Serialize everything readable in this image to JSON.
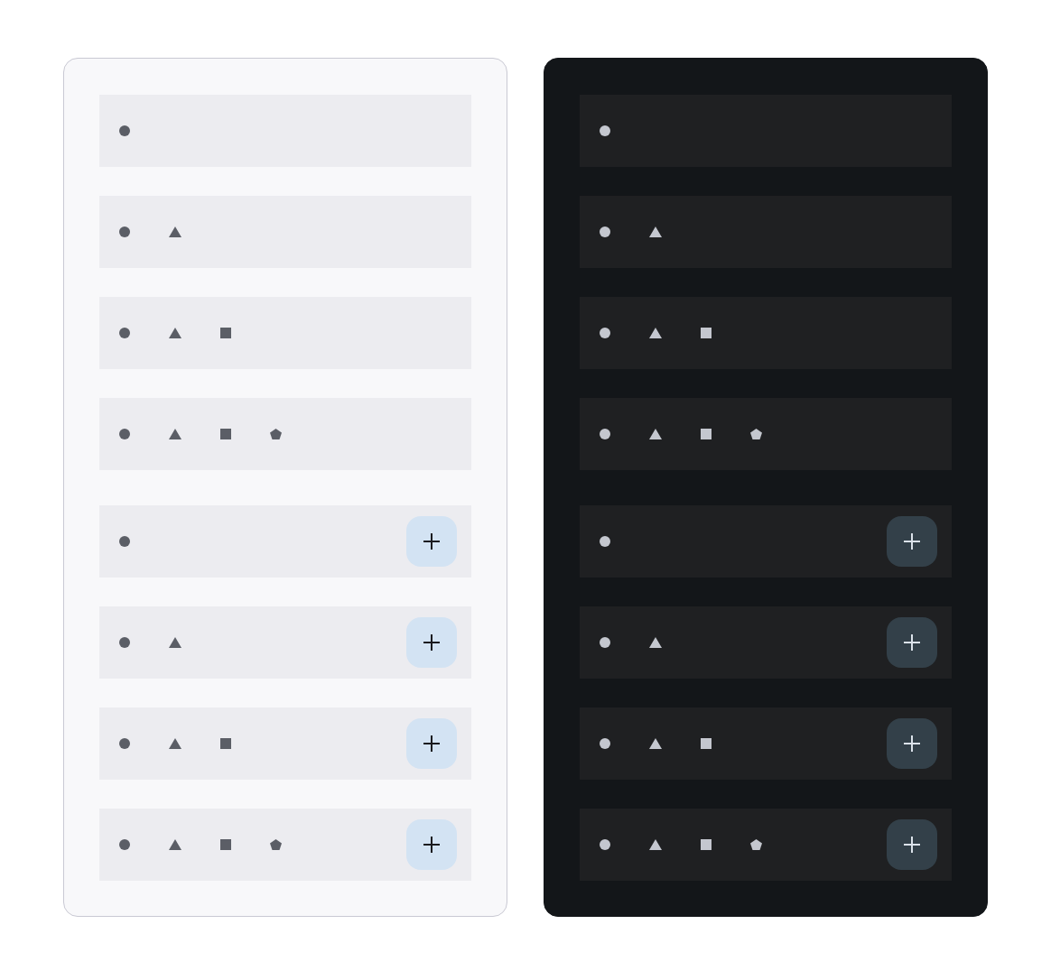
{
  "panels": [
    {
      "kind": "light",
      "groups": [
        {
          "add_button": false,
          "rows": [
            {
              "icons": [
                {
                  "kind": "circle"
                }
              ]
            },
            {
              "icons": [
                {
                  "kind": "circle"
                },
                {
                  "kind": "triangle"
                }
              ]
            },
            {
              "icons": [
                {
                  "kind": "circle"
                },
                {
                  "kind": "triangle"
                },
                {
                  "kind": "square"
                }
              ]
            },
            {
              "icons": [
                {
                  "kind": "circle"
                },
                {
                  "kind": "triangle"
                },
                {
                  "kind": "square"
                },
                {
                  "kind": "pentagon"
                }
              ]
            }
          ]
        },
        {
          "add_button": true,
          "rows": [
            {
              "icons": [
                {
                  "kind": "circle"
                }
              ]
            },
            {
              "icons": [
                {
                  "kind": "circle"
                },
                {
                  "kind": "triangle"
                }
              ]
            },
            {
              "icons": [
                {
                  "kind": "circle"
                },
                {
                  "kind": "triangle"
                },
                {
                  "kind": "square"
                }
              ]
            },
            {
              "icons": [
                {
                  "kind": "circle"
                },
                {
                  "kind": "triangle"
                },
                {
                  "kind": "square"
                },
                {
                  "kind": "pentagon"
                }
              ]
            }
          ]
        }
      ]
    },
    {
      "kind": "dark",
      "groups": [
        {
          "add_button": false,
          "rows": [
            {
              "icons": [
                {
                  "kind": "circle"
                }
              ]
            },
            {
              "icons": [
                {
                  "kind": "circle"
                },
                {
                  "kind": "triangle"
                }
              ]
            },
            {
              "icons": [
                {
                  "kind": "circle"
                },
                {
                  "kind": "triangle"
                },
                {
                  "kind": "square"
                }
              ]
            },
            {
              "icons": [
                {
                  "kind": "circle"
                },
                {
                  "kind": "triangle"
                },
                {
                  "kind": "square"
                },
                {
                  "kind": "pentagon"
                }
              ]
            }
          ]
        },
        {
          "add_button": true,
          "rows": [
            {
              "icons": [
                {
                  "kind": "circle"
                }
              ]
            },
            {
              "icons": [
                {
                  "kind": "circle"
                },
                {
                  "kind": "triangle"
                }
              ]
            },
            {
              "icons": [
                {
                  "kind": "circle"
                },
                {
                  "kind": "triangle"
                },
                {
                  "kind": "square"
                }
              ]
            },
            {
              "icons": [
                {
                  "kind": "circle"
                },
                {
                  "kind": "triangle"
                },
                {
                  "kind": "square"
                },
                {
                  "kind": "pentagon"
                }
              ]
            }
          ]
        }
      ]
    }
  ]
}
